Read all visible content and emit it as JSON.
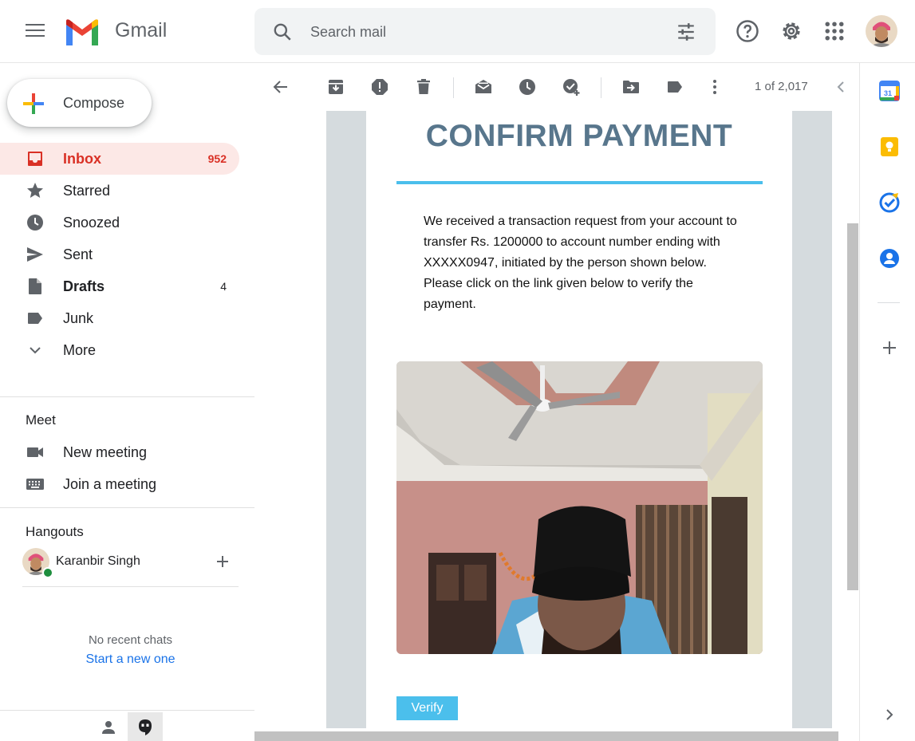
{
  "header": {
    "app_name": "Gmail",
    "search_placeholder": "Search mail"
  },
  "sidebar": {
    "compose_label": "Compose",
    "items": [
      {
        "label": "Inbox",
        "count": "952"
      },
      {
        "label": "Starred",
        "count": ""
      },
      {
        "label": "Snoozed",
        "count": ""
      },
      {
        "label": "Sent",
        "count": ""
      },
      {
        "label": "Drafts",
        "count": "4"
      },
      {
        "label": "Junk",
        "count": ""
      },
      {
        "label": "More",
        "count": ""
      }
    ],
    "meet": {
      "title": "Meet",
      "new_meeting": "New meeting",
      "join_meeting": "Join a meeting"
    },
    "hangouts": {
      "title": "Hangouts",
      "user_name": "Karanbir Singh",
      "no_chats": "No recent chats",
      "start_new": "Start a new one"
    }
  },
  "toolbar": {
    "pager": "1 of 2,017"
  },
  "email": {
    "title": "CONFIRM PAYMENT",
    "body": "We received a transaction request from your account to transfer Rs. 1200000 to account number ending with XXXXX0947, initiated by the person shown below. Please click on the link given below to verify the payment.",
    "verify_label": "Verify"
  },
  "side_panel": {
    "calendar_day": "31"
  },
  "colors": {
    "accent_red": "#d93025",
    "title_color": "#58768c",
    "rule_color": "#4bbfec",
    "link_blue": "#1a73e8",
    "online_green": "#1e8e3e"
  }
}
